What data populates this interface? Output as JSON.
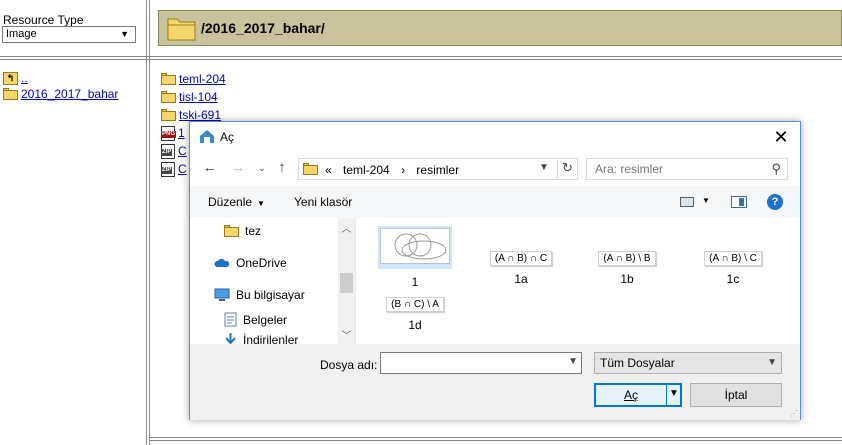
{
  "page": {
    "resource_type_label": "Resource Type",
    "resource_type_value": "Image",
    "current_path": "/2016_2017_bahar/",
    "tree": [
      {
        "label": ".."
      },
      {
        "label": "2016_2017_bahar"
      }
    ],
    "files": [
      {
        "label": "teml-204",
        "kind": "folder"
      },
      {
        "label": "tisl-104",
        "kind": "folder"
      },
      {
        "label": "tski-691",
        "kind": "folder"
      },
      {
        "label": "1",
        "kind": "png"
      },
      {
        "label": "C",
        "kind": "zip"
      },
      {
        "label": "C",
        "kind": "zip"
      }
    ]
  },
  "dialog": {
    "title": "Aç",
    "breadcrumbs": [
      "«",
      "teml-204",
      "›",
      "resimler"
    ],
    "search_placeholder": "Ara: resimler",
    "toolbar": {
      "organize": "Düzenle",
      "new_folder": "Yeni klasör"
    },
    "nav_items": [
      {
        "label": "tez",
        "icon": "folder-icon"
      },
      {
        "label": "OneDrive",
        "icon": "cloud-icon"
      },
      {
        "label": "Bu bilgisayar",
        "icon": "computer-icon"
      },
      {
        "label": "Belgeler",
        "icon": "documents-icon"
      },
      {
        "label": "İndirilenler",
        "icon": "download-icon"
      }
    ],
    "files": [
      {
        "name": "1",
        "preview": "",
        "selected": true
      },
      {
        "name": "1a",
        "preview": "(A ∩ B) ∩ C"
      },
      {
        "name": "1b",
        "preview": "(A ∩ B) \\ B"
      },
      {
        "name": "1c",
        "preview": "(A ∩ B) \\ C"
      },
      {
        "name": "1d",
        "preview": "(B ∩ C) \\ A"
      }
    ],
    "file_name_label": "Dosya adı:",
    "file_name_value": "",
    "file_type": "Tüm Dosyalar",
    "open_label": "Aç",
    "cancel_label": "İptal"
  },
  "colors": {
    "path_bar": "#c8c39c",
    "link": "#0000cc",
    "accent": "#0078d7",
    "help": "#1f6fcf"
  }
}
